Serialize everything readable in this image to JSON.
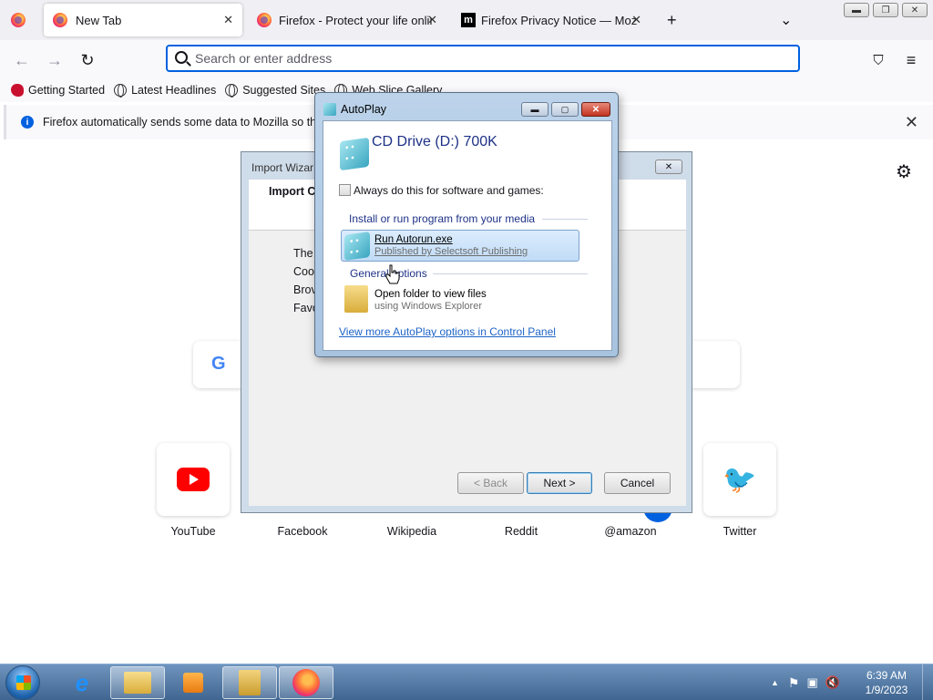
{
  "browser": {
    "tabs": [
      {
        "label": "New Tab",
        "active": true
      },
      {
        "label": "Firefox - Protect your life online",
        "active": false
      },
      {
        "label": "Firefox Privacy Notice — Mozilla",
        "active": false
      }
    ],
    "new_tab_symbol": "+",
    "list_tabs_symbol": "⌄",
    "url_placeholder": "Search or enter address",
    "bookmarks": [
      "Getting Started",
      "Latest Headlines",
      "Suggested Sites",
      "Web Slice Gallery"
    ],
    "notification": "Firefox automatically sends some data to Mozilla so that we"
  },
  "newtab": {
    "shortcuts": [
      "YouTube",
      "Facebook",
      "Wikipedia",
      "Reddit",
      "@amazon",
      "Twitter"
    ]
  },
  "import_wizard": {
    "title": "Import Wizar",
    "header_title": "Import C",
    "body_lines": [
      "The",
      "Coo",
      "Brov",
      "Favo"
    ],
    "back_label": "< Back",
    "next_label": "Next >",
    "cancel_label": "Cancel"
  },
  "autoplay": {
    "title": "AutoPlay",
    "device": "CD Drive (D:) 700K",
    "always_checkbox": "Always do this for software and games:",
    "section1": "Install or run program from your media",
    "option1_title": "Run Autorun.exe",
    "option1_sub": "Published by Selectsoft Publishing",
    "section2": "General options",
    "option2_title": "Open folder to view files",
    "option2_sub": "using Windows Explorer",
    "link": "View more AutoPlay options in Control Panel"
  },
  "taskbar": {
    "time": "6:39 AM",
    "date": "1/9/2023"
  }
}
